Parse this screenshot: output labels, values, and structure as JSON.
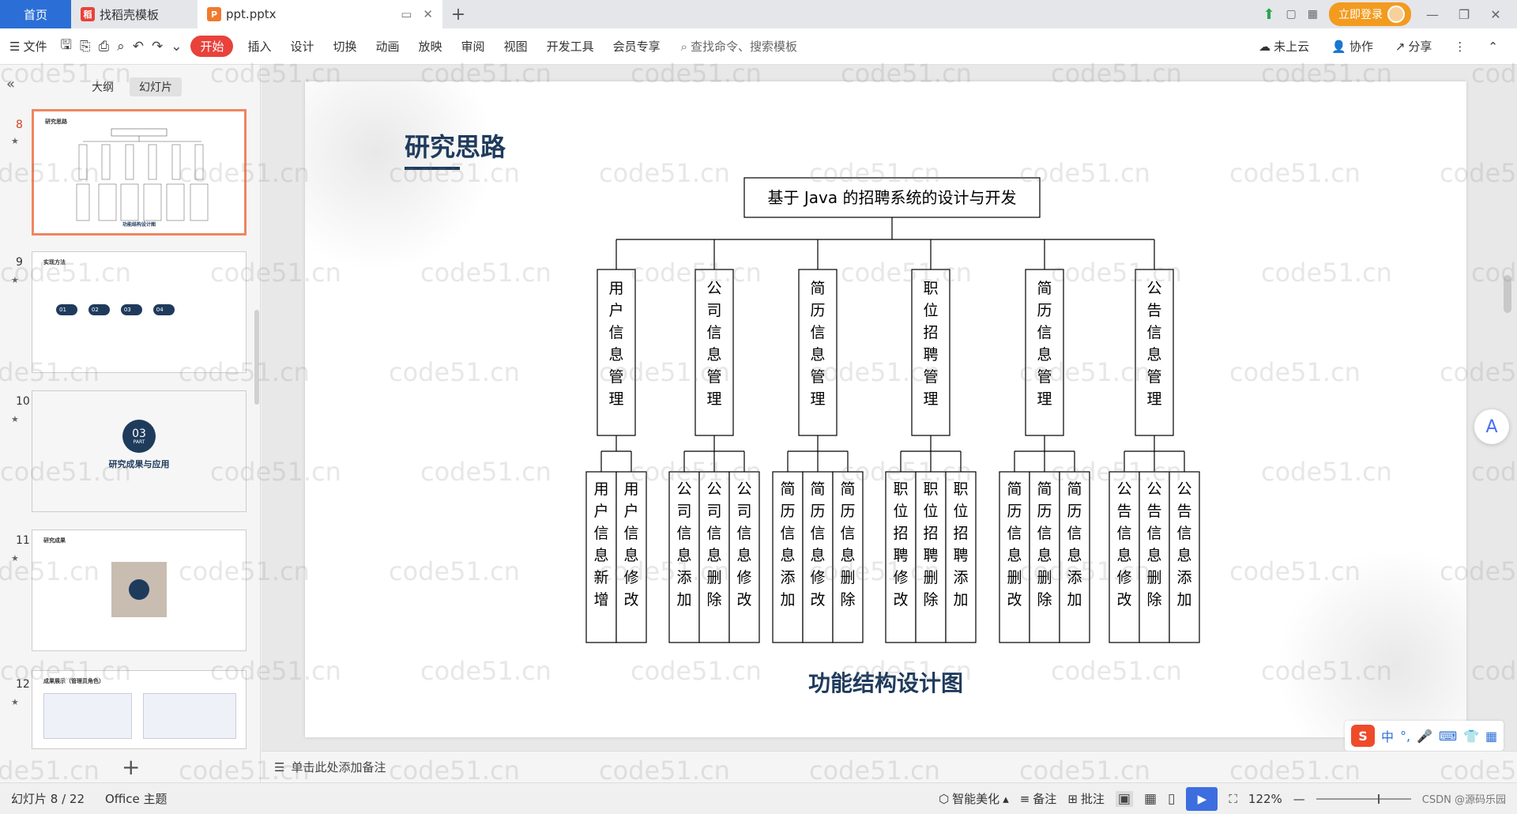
{
  "tabs": {
    "home": "首页",
    "daoke": "找稻壳模板",
    "active_file": "ppt.pptx"
  },
  "top_right": {
    "login": "立即登录"
  },
  "ribbon": {
    "file": "文件",
    "tabs": [
      "开始",
      "插入",
      "设计",
      "切换",
      "动画",
      "放映",
      "审阅",
      "视图",
      "开发工具",
      "会员专享"
    ],
    "search": "查找命令、搜索模板",
    "cloud": "未上云",
    "collab": "协作",
    "share": "分享"
  },
  "left_panel": {
    "tab_outline": "大纲",
    "tab_slides": "幻灯片",
    "slides": [
      {
        "num": "8",
        "title": "研究思路",
        "caption": "功能结构设计图"
      },
      {
        "num": "9",
        "title": "实现方法",
        "steps": [
          "01",
          "02",
          "03",
          "04"
        ]
      },
      {
        "num": "10",
        "badge": "03",
        "badge_sub": "PART",
        "title": "研究成果与应用"
      },
      {
        "num": "11",
        "title": "研究成果"
      },
      {
        "num": "12",
        "title": "成果展示（管理员角色）"
      }
    ]
  },
  "slide": {
    "title": "研究思路",
    "caption": "功能结构设计图",
    "org": {
      "root": "基于 Java 的招聘系统的设计与开发",
      "modules": [
        {
          "name": "用户信息管理",
          "children": [
            "用户信息新增",
            "用户信息修改"
          ]
        },
        {
          "name": "公司信息管理",
          "children": [
            "公司信息添加",
            "公司信息删除",
            "公司信息修改"
          ]
        },
        {
          "name": "简历信息管理",
          "children": [
            "简历信息添加",
            "简历信息修改",
            "简历信息删除"
          ]
        },
        {
          "name": "职位招聘管理",
          "children": [
            "职位招聘修改",
            "职位招聘删除",
            "职位招聘添加"
          ]
        },
        {
          "name": "简历信息管理",
          "children": [
            "简历信息删改",
            "简历信息删除",
            "简历信息添加"
          ]
        },
        {
          "name": "公告信息管理",
          "children": [
            "公告信息修改",
            "公告信息删除",
            "公告信息添加"
          ]
        }
      ]
    }
  },
  "notes": "单击此处添加备注",
  "status": {
    "slide_indicator": "幻灯片 8 / 22",
    "theme": "Office 主题",
    "beautify": "智能美化",
    "notes": "备注",
    "comments": "批注",
    "zoom": "122%"
  },
  "ime": {
    "lang": "中"
  },
  "watermark": "code51.cn",
  "footer_credit": "CSDN @源码乐园",
  "colors": {
    "accent_red": "#e8423b",
    "title_navy": "#1f3b5c",
    "home_blue": "#2b6fd6",
    "login_orange": "#f39b1f"
  }
}
